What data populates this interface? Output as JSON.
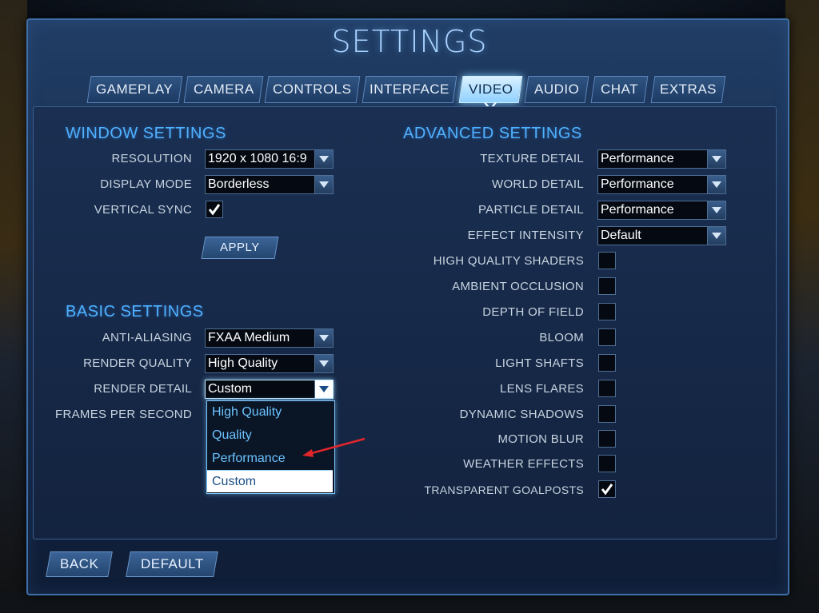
{
  "title": "SETTINGS",
  "tabs": [
    {
      "label": "GAMEPLAY",
      "active": false
    },
    {
      "label": "CAMERA",
      "active": false
    },
    {
      "label": "CONTROLS",
      "active": false
    },
    {
      "label": "INTERFACE",
      "active": false
    },
    {
      "label": "VIDEO",
      "active": true
    },
    {
      "label": "AUDIO",
      "active": false
    },
    {
      "label": "CHAT",
      "active": false
    },
    {
      "label": "EXTRAS",
      "active": false
    }
  ],
  "window_settings": {
    "title": "WINDOW SETTINGS",
    "resolution": {
      "label": "RESOLUTION",
      "value": "1920 x 1080 16:9"
    },
    "display_mode": {
      "label": "DISPLAY MODE",
      "value": "Borderless"
    },
    "vertical_sync": {
      "label": "VERTICAL SYNC",
      "checked": true
    },
    "apply_label": "APPLY"
  },
  "basic_settings": {
    "title": "BASIC SETTINGS",
    "anti_aliasing": {
      "label": "ANTI-ALIASING",
      "value": "FXAA Medium"
    },
    "render_quality": {
      "label": "RENDER QUALITY",
      "value": "High Quality"
    },
    "render_detail": {
      "label": "RENDER DETAIL",
      "value": "Custom",
      "options": [
        "High Quality",
        "Quality",
        "Performance",
        "Custom"
      ],
      "selected": "Custom"
    },
    "fps": {
      "label": "FRAMES PER SECOND"
    }
  },
  "advanced_settings": {
    "title": "ADVANCED SETTINGS",
    "texture_detail": {
      "label": "TEXTURE DETAIL",
      "value": "Performance"
    },
    "world_detail": {
      "label": "WORLD DETAIL",
      "value": "Performance"
    },
    "particle_detail": {
      "label": "PARTICLE DETAIL",
      "value": "Performance"
    },
    "effect_intensity": {
      "label": "EFFECT INTENSITY",
      "value": "Default"
    },
    "toggles": [
      {
        "label": "HIGH QUALITY SHADERS",
        "checked": false
      },
      {
        "label": "AMBIENT OCCLUSION",
        "checked": false
      },
      {
        "label": "DEPTH OF FIELD",
        "checked": false
      },
      {
        "label": "BLOOM",
        "checked": false
      },
      {
        "label": "LIGHT SHAFTS",
        "checked": false
      },
      {
        "label": "LENS FLARES",
        "checked": false
      },
      {
        "label": "DYNAMIC SHADOWS",
        "checked": false
      },
      {
        "label": "MOTION BLUR",
        "checked": false
      },
      {
        "label": "WEATHER EFFECTS",
        "checked": false
      },
      {
        "label": "TRANSPARENT GOALPOSTS",
        "checked": true
      }
    ]
  },
  "footer": {
    "back_label": "BACK",
    "default_label": "DEFAULT"
  },
  "colors": {
    "accent": "#4fb1ff",
    "panel": "#16294a",
    "active_tab": "#8fd0ff",
    "annotation_arrow": "#e0262b"
  }
}
